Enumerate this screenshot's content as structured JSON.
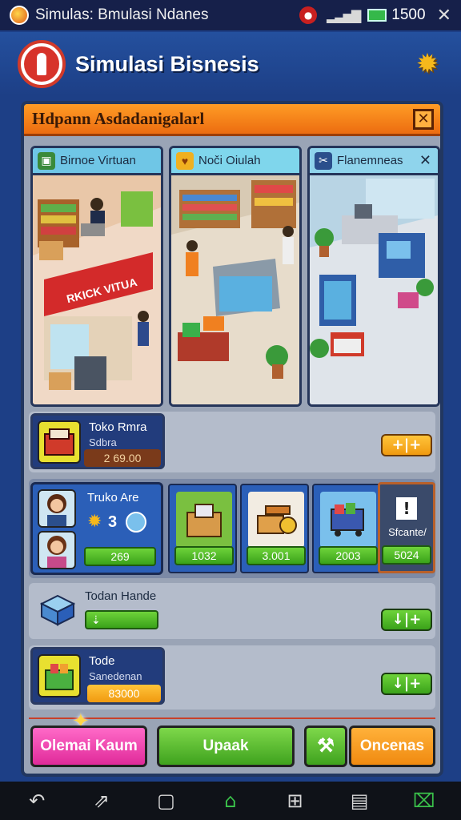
{
  "statusbar": {
    "title": "Simulas: Bmulasi Ndanes",
    "time": "1500"
  },
  "header": {
    "title": "Simulasi Bisnesis"
  },
  "panel": {
    "title": "Hdpann Asdadanigalarl"
  },
  "scenes": [
    {
      "label": "Birnoe Virtuan",
      "icon": "gift-icon",
      "color": "#6fc6e6"
    },
    {
      "label": "Noči Oiulah",
      "icon": "shield-heart-icon",
      "color": "#7fd6ec"
    },
    {
      "label": "Flanemneas",
      "icon": "tools-icon",
      "color": "#8fd4ec"
    }
  ],
  "shop_sign": "RKICK VITUA",
  "rows": {
    "toko_rmra": {
      "title": "Toko Rmra",
      "sub": "Sdbra",
      "amount": "2 69.00",
      "action": "+|+"
    },
    "truko_are": {
      "title": "Truko Are",
      "level": "3",
      "amount": "269"
    },
    "tiles": [
      {
        "value": "1032",
        "icon": "box-icon"
      },
      {
        "value": "3.001",
        "icon": "tape-icon"
      },
      {
        "value": "2003",
        "icon": "cart-icon"
      }
    ],
    "side_card": {
      "mark": "!",
      "label": "Sfcante/",
      "value": "5024"
    },
    "todan": {
      "title": "Todan Hande",
      "bar": "⇣",
      "action": "↓|+"
    },
    "tode": {
      "title": "Tode",
      "sub": "Sanedenan",
      "amount": "83000",
      "action": "↓|+"
    }
  },
  "buttons": {
    "left": "Olemai Kaum",
    "middle": "Upaak",
    "right": "Oncenas"
  },
  "colors": {
    "accent_orange": "#ec6c10",
    "accent_green": "#4db22a",
    "accent_pink": "#e83aa6",
    "bg_blue": "#1d3f86"
  }
}
